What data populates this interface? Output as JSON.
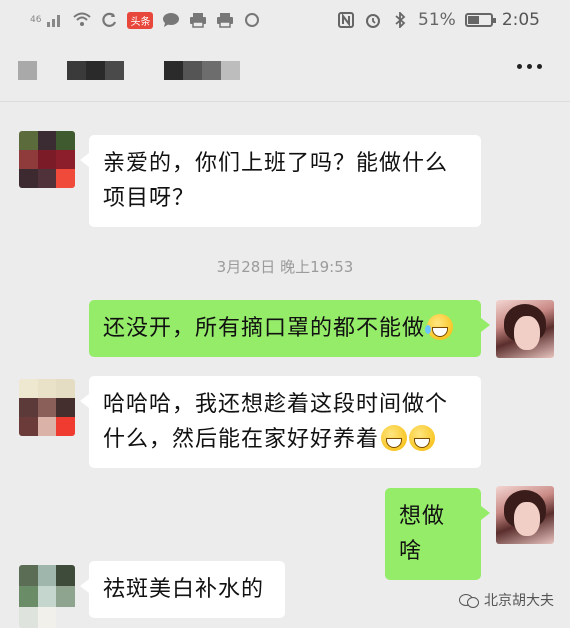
{
  "status_bar": {
    "signal": "46",
    "app_badge": "头条",
    "battery_percent": "51%",
    "battery_level": 0.51,
    "time": "2:05",
    "left_icons": [
      "signal-icon",
      "wifi-icon",
      "sync-icon",
      "toutiao-icon",
      "chat-icon",
      "printer-icon",
      "printer-icon",
      "circle-icon"
    ],
    "right_icons": [
      "nfc-icon",
      "alarm-icon",
      "bluetooth-icon",
      "battery-icon"
    ]
  },
  "header": {
    "contact_name_redacted": true,
    "menu_icon": "more-icon"
  },
  "chat": {
    "messages": [
      {
        "from": "contact",
        "text": "亲爱的，你们上班了吗？能做什么项目呀？"
      },
      {
        "timestamp": "3月28日 晚上19:53"
      },
      {
        "from": "me",
        "text": "还没开，所有摘口罩的都不能做",
        "emoji": "joy-tears-emoji"
      },
      {
        "from": "contact",
        "text": " 哈哈哈，我还想趁着这段时间做个什么，然后能在家好好养着",
        "emoji": "grin-emoji"
      },
      {
        "from": "me",
        "text": "想做啥"
      },
      {
        "from": "contact",
        "text": "祛斑美白补水的"
      }
    ]
  },
  "watermark": {
    "text": "北京胡大夫",
    "icon": "wechat-icon"
  }
}
